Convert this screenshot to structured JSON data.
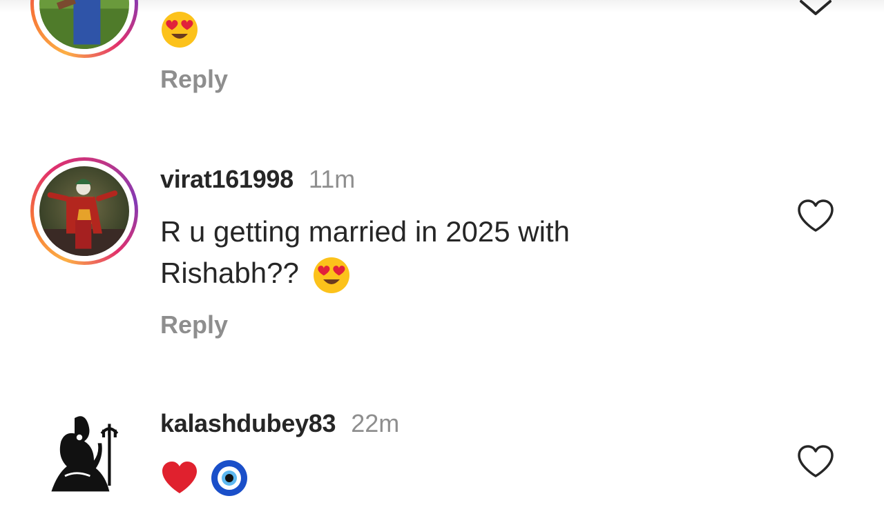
{
  "comments": [
    {
      "username": "",
      "time": "",
      "text": "",
      "emojis": [
        "heart-eyes-emoji"
      ],
      "reply_label": "Reply",
      "story_ring": true
    },
    {
      "username": "virat161998",
      "time": "11m",
      "text_line1": "R u getting married in 2025 with",
      "text_line2": "Rishabh??",
      "emojis": [
        "heart-eyes-emoji"
      ],
      "reply_label": "Reply",
      "story_ring": true
    },
    {
      "username": "kalashdubey83",
      "time": "22m",
      "emojis": [
        "red-heart-emoji",
        "nazar-amulet-emoji"
      ],
      "story_ring": false
    }
  ],
  "icons": {
    "like": "heart-outline-icon",
    "collapse": "chevron-down-icon"
  },
  "colors": {
    "text_primary": "#262626",
    "text_secondary": "#8e8e8e",
    "story_ring_start": "#fcaf45",
    "story_ring_end": "#c13584"
  }
}
